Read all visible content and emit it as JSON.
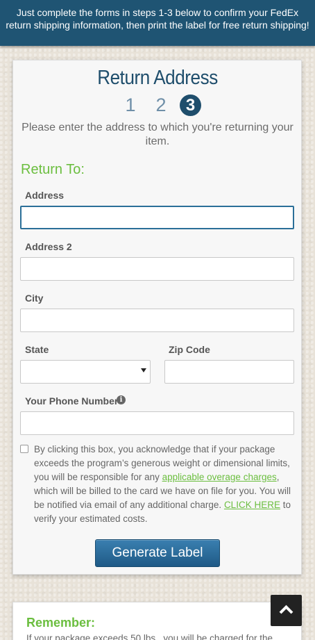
{
  "banner": {
    "text": "Just complete the forms in steps 1-3 below to confirm your FedEx return shipping information, then print the label for free return shipping!"
  },
  "page": {
    "title": "Return Address",
    "steps": [
      "1",
      "2",
      "3"
    ],
    "subtitle": "Please enter the address to which you're returning your item.",
    "section_heading": "Return To:"
  },
  "form": {
    "address_label": "Address",
    "address_value": "",
    "address2_label": "Address 2",
    "address2_value": "",
    "city_label": "City",
    "city_value": "",
    "state_label": "State",
    "state_value": "",
    "zip_label": "Zip Code",
    "zip_value": "",
    "phone_label": "Your Phone Number",
    "phone_value": ""
  },
  "terms": {
    "text_1": "By clicking this box, you acknowledge that if your package exceeds the program’s generous weight or dimensional limits, you will be responsible for any ",
    "link_1": "applicable overage charges",
    "text_2": ", which will be billed to the card we have on file for you. You will be notified via email of any additional charge. ",
    "link_2": "CLICK HERE",
    "text_3": " to verify your estimated costs."
  },
  "actions": {
    "generate_label": "Generate Label"
  },
  "remember": {
    "heading": "Remember:",
    "text": "If your package exceeds 50 lbs., you will be charged for the"
  },
  "colors": {
    "banner": "#1f5473",
    "title": "#1f4e6c",
    "accent_green": "#6bbe3f",
    "button": "#2a6c9c"
  },
  "icons": {
    "info": "info-circle-icon",
    "select": "caret-down-icon",
    "scroll_top": "chevron-up-icon"
  }
}
